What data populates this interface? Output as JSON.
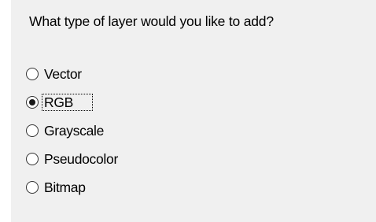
{
  "dialog": {
    "prompt": "What type of layer would you like to add?"
  },
  "options": [
    {
      "label": "Vector",
      "checked": false
    },
    {
      "label": "RGB",
      "checked": true,
      "focused": true
    },
    {
      "label": "Grayscale",
      "checked": false
    },
    {
      "label": "Pseudocolor",
      "checked": false
    },
    {
      "label": "Bitmap",
      "checked": false
    }
  ]
}
